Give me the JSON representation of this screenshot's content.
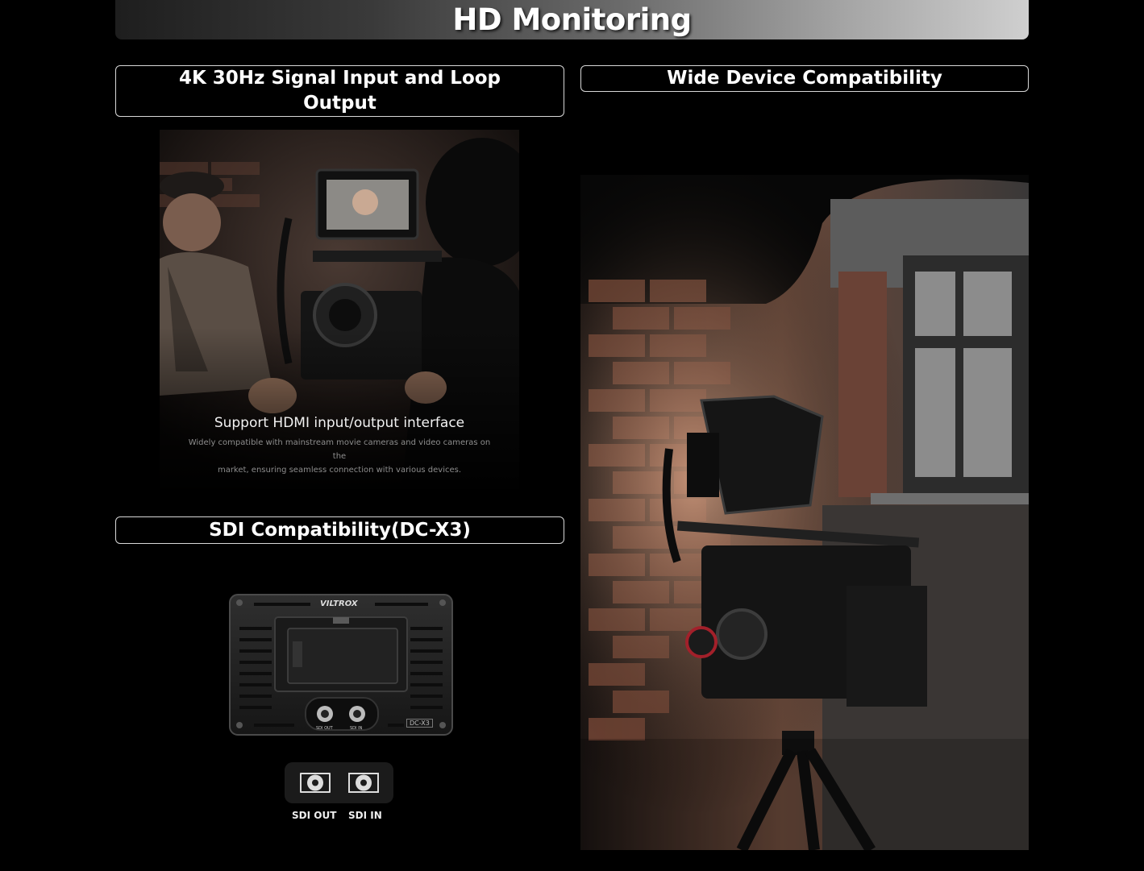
{
  "header": {
    "title": "HD Monitoring"
  },
  "sections": {
    "signal": {
      "title_line1": "4K 30Hz Signal Input and Loop",
      "title_line2": "Output",
      "caption": "Support HDMI input/output interface",
      "subcaption_line1": "Widely compatible with mainstream movie cameras and video cameras on the",
      "subcaption_line2": "market, ensuring seamless connection with various devices."
    },
    "compat": {
      "title": "Wide Device Compatibility"
    },
    "sdi": {
      "title": "SDI Compatibility(DC-X3)",
      "brand": "VILTROX",
      "model": "DC-X3",
      "port_out": "SDI OUT",
      "port_in": "SDI IN",
      "small_out": "SDI OUT",
      "small_in": "SDI IN"
    }
  },
  "colors": {
    "background": "#000000",
    "box_border": "#d8d8d8",
    "text": "#ffffff"
  }
}
